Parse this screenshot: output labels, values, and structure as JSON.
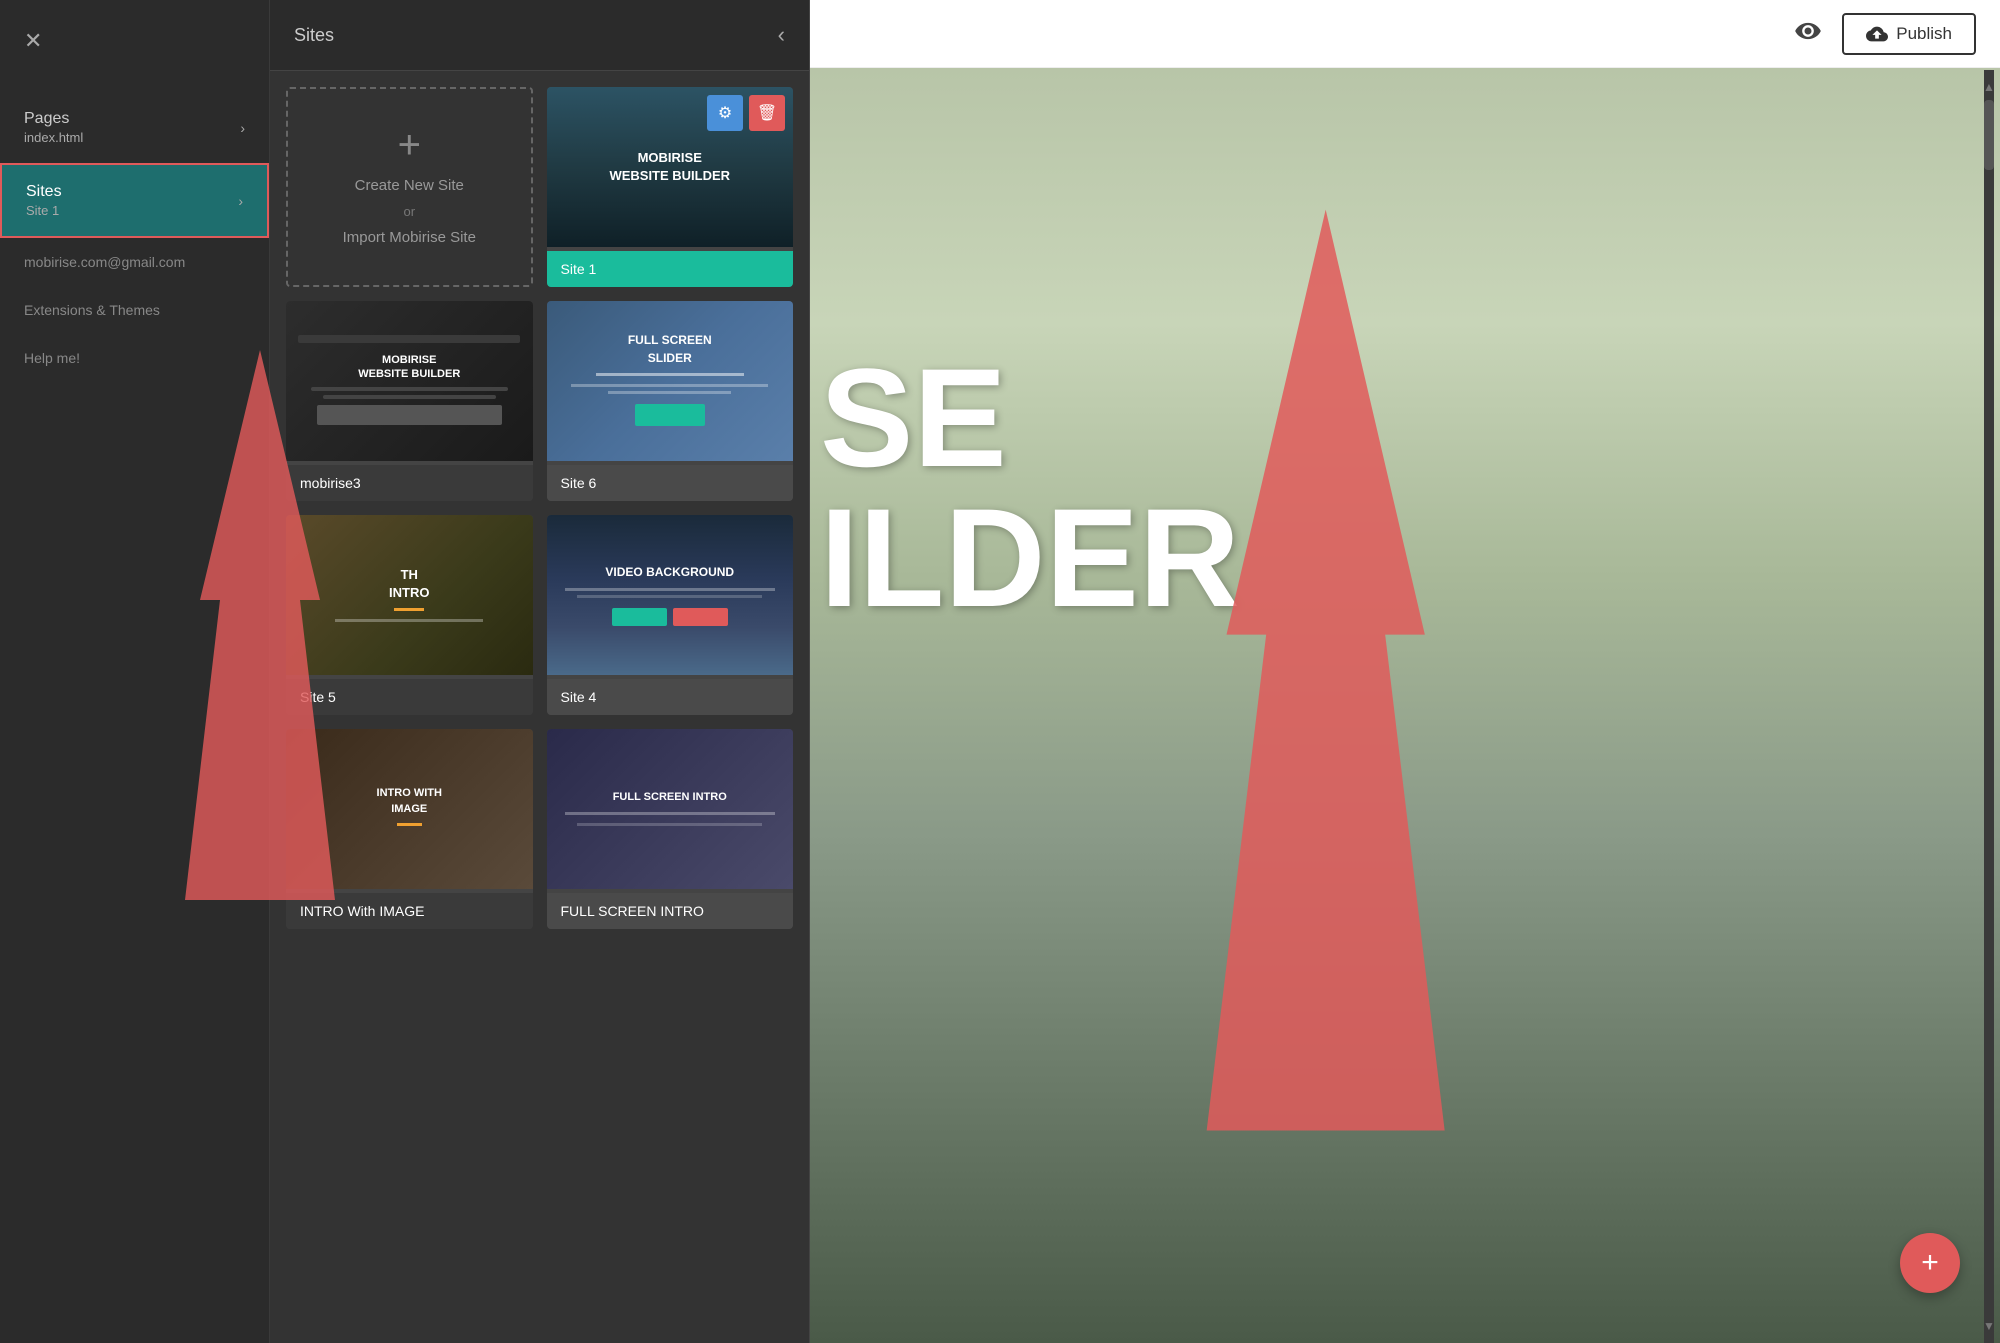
{
  "sidebar": {
    "close_icon": "✕",
    "nav_items": [
      {
        "id": "pages",
        "label": "Pages",
        "sub": "index.html",
        "chevron": "›",
        "active": false
      },
      {
        "id": "sites",
        "label": "Sites",
        "sub": "Site 1",
        "chevron": "›",
        "active": true
      }
    ],
    "user_email": "mobirise.com@gmail.com",
    "extensions_label": "Extensions & Themes",
    "help_label": "Help me!"
  },
  "sites_panel": {
    "title": "Sites",
    "close_icon": "‹",
    "create_new": {
      "plus_icon": "+",
      "label": "Create New Site",
      "or_text": "or",
      "import_label": "Import Mobirise Site"
    },
    "sites": [
      {
        "id": "site1",
        "name": "Site 1",
        "thumb_type": "mobirise",
        "thumb_text_line1": "MOBIRISE",
        "thumb_text_line2": "WEBSITE BUILDER",
        "footer_color": "teal",
        "has_actions": true
      },
      {
        "id": "mobirise3",
        "name": "mobirise3",
        "thumb_type": "mobirise3",
        "thumb_text_line1": "MOBIRISE",
        "thumb_text_line2": "WEBSITE BUILDER",
        "footer_color": "gray1",
        "has_actions": false
      },
      {
        "id": "site6",
        "name": "Site 6",
        "thumb_type": "fullscreen-slider",
        "thumb_text_line1": "FULL SCREEN",
        "thumb_text_line2": "SLIDER",
        "footer_color": "gray2",
        "has_actions": false
      },
      {
        "id": "site5",
        "name": "Site 5",
        "thumb_type": "intro",
        "thumb_text_line1": "TH",
        "thumb_text_line2": "INTRO",
        "footer_color": "gray1",
        "has_actions": false
      },
      {
        "id": "site4",
        "name": "Site 4",
        "thumb_type": "video-bg",
        "thumb_text_line1": "VIDEO BACKGROUND",
        "thumb_text_line2": "",
        "footer_color": "gray2",
        "has_actions": false
      },
      {
        "id": "intro-image",
        "name": "INTRO With IMAGE",
        "thumb_type": "intro-image",
        "thumb_text_line1": "INTRO WITH",
        "thumb_text_line2": "IMAGE",
        "footer_color": "gray1",
        "has_actions": false
      },
      {
        "id": "fullscreen-intro",
        "name": "FULL SCREEN INTRO",
        "thumb_type": "fullscreen-intro",
        "thumb_text_line1": "FULL SCREEN INTRO",
        "thumb_text_line2": "",
        "footer_color": "gray2",
        "has_actions": false
      }
    ]
  },
  "header": {
    "preview_icon": "👁",
    "publish_icon": "☁",
    "publish_label": "Publish"
  },
  "main": {
    "bg_text_se": "SE",
    "bg_text_ilder": "ILDER"
  },
  "fab": {
    "icon": "+"
  }
}
